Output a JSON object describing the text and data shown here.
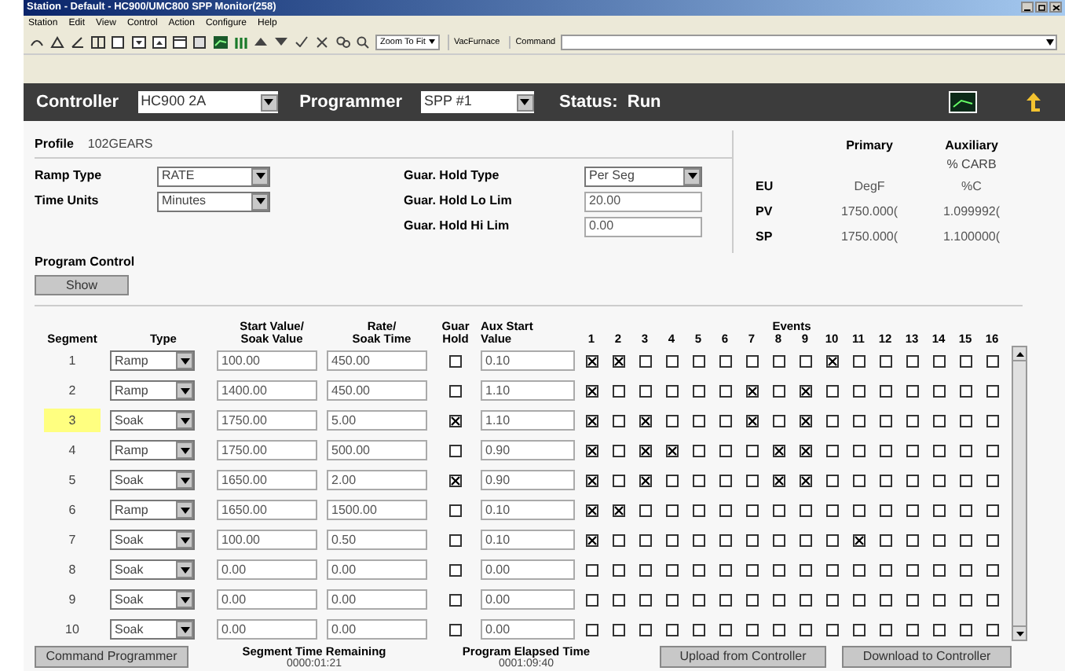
{
  "window": {
    "title": "Station - Default - HC900/UMC800 SPP Monitor(258)"
  },
  "menu": [
    "Station",
    "Edit",
    "View",
    "Control",
    "Action",
    "Configure",
    "Help"
  ],
  "toolbar": {
    "zoom": "Zoom To Fit",
    "furnace_button": "VacFurnace",
    "command_label": "Command"
  },
  "header": {
    "controller_label": "Controller",
    "controller": "HC900 2A",
    "programmer_label": "Programmer",
    "programmer": "SPP #1",
    "status": "Status:  Run"
  },
  "profile": {
    "label": "Profile",
    "value": "102GEARS"
  },
  "settings": [
    {
      "label": "Ramp Type",
      "kind": "select",
      "value": "RATE"
    },
    {
      "label": "Time Units",
      "kind": "select",
      "value": "Minutes"
    }
  ],
  "hold_settings": [
    {
      "label": "Guar. Hold Type",
      "kind": "select",
      "value": "Per Seg"
    },
    {
      "label": "Guar. Hold Lo Lim",
      "kind": "input",
      "value": "20.00"
    },
    {
      "label": "Guar. Hold Hi Lim",
      "kind": "input",
      "value": "0.00"
    }
  ],
  "readings": {
    "columns": [
      "Primary",
      "Auxiliary"
    ],
    "aux_unit": "% CARB",
    "rows": [
      {
        "label": "EU",
        "primary": "DegF",
        "auxiliary": "%C"
      },
      {
        "label": "PV",
        "primary": "1750.000(",
        "auxiliary": "1.099992("
      },
      {
        "label": "SP",
        "primary": "1750.000(",
        "auxiliary": "1.100000("
      }
    ]
  },
  "program_control": {
    "label": "Program Control",
    "button": "Show"
  },
  "table": {
    "columns": [
      "Segment",
      "Type",
      "Start Value/\nSoak Value",
      "Rate/\nSoak Time",
      "Guar\nHold",
      "Aux Start\nValue"
    ],
    "events_label": "Events",
    "event_numbers": [
      "1",
      "2",
      "3",
      "4",
      "5",
      "6",
      "7",
      "8",
      "9",
      "10",
      "11",
      "12",
      "13",
      "14",
      "15",
      "16"
    ],
    "rows": [
      {
        "segment": "1",
        "selected": false,
        "type": "Ramp",
        "start": "100.00",
        "rate": "450.00",
        "hold": false,
        "aux": "0.10",
        "events": [
          true,
          true,
          false,
          false,
          false,
          false,
          false,
          false,
          false,
          true,
          false,
          false,
          false,
          false,
          false,
          false
        ]
      },
      {
        "segment": "2",
        "selected": false,
        "type": "Ramp",
        "start": "1400.00",
        "rate": "450.00",
        "hold": false,
        "aux": "1.10",
        "events": [
          true,
          false,
          false,
          false,
          false,
          false,
          true,
          false,
          true,
          false,
          false,
          false,
          false,
          false,
          false,
          false
        ]
      },
      {
        "segment": "3",
        "selected": true,
        "type": "Soak",
        "start": "1750.00",
        "rate": "5.00",
        "hold": true,
        "aux": "1.10",
        "events": [
          true,
          false,
          true,
          false,
          false,
          false,
          true,
          false,
          true,
          false,
          false,
          false,
          false,
          false,
          false,
          false
        ]
      },
      {
        "segment": "4",
        "selected": false,
        "type": "Ramp",
        "start": "1750.00",
        "rate": "500.00",
        "hold": false,
        "aux": "0.90",
        "events": [
          true,
          false,
          true,
          true,
          false,
          false,
          false,
          true,
          true,
          false,
          false,
          false,
          false,
          false,
          false,
          false
        ]
      },
      {
        "segment": "5",
        "selected": false,
        "type": "Soak",
        "start": "1650.00",
        "rate": "2.00",
        "hold": true,
        "aux": "0.90",
        "events": [
          true,
          false,
          true,
          false,
          false,
          false,
          false,
          true,
          true,
          false,
          false,
          false,
          false,
          false,
          false,
          false
        ]
      },
      {
        "segment": "6",
        "selected": false,
        "type": "Ramp",
        "start": "1650.00",
        "rate": "1500.00",
        "hold": false,
        "aux": "0.10",
        "events": [
          true,
          true,
          false,
          false,
          false,
          false,
          false,
          false,
          false,
          false,
          false,
          false,
          false,
          false,
          false,
          false
        ]
      },
      {
        "segment": "7",
        "selected": false,
        "type": "Soak",
        "start": "100.00",
        "rate": "0.50",
        "hold": false,
        "aux": "0.10",
        "events": [
          true,
          false,
          false,
          false,
          false,
          false,
          false,
          false,
          false,
          false,
          true,
          false,
          false,
          false,
          false,
          false
        ]
      },
      {
        "segment": "8",
        "selected": false,
        "type": "Soak",
        "start": "0.00",
        "rate": "0.00",
        "hold": false,
        "aux": "0.00",
        "events": [
          false,
          false,
          false,
          false,
          false,
          false,
          false,
          false,
          false,
          false,
          false,
          false,
          false,
          false,
          false,
          false
        ]
      },
      {
        "segment": "9",
        "selected": false,
        "type": "Soak",
        "start": "0.00",
        "rate": "0.00",
        "hold": false,
        "aux": "0.00",
        "events": [
          false,
          false,
          false,
          false,
          false,
          false,
          false,
          false,
          false,
          false,
          false,
          false,
          false,
          false,
          false,
          false
        ]
      },
      {
        "segment": "10",
        "selected": false,
        "type": "Soak",
        "start": "0.00",
        "rate": "0.00",
        "hold": false,
        "aux": "0.00",
        "events": [
          false,
          false,
          false,
          false,
          false,
          false,
          false,
          false,
          false,
          false,
          false,
          false,
          false,
          false,
          false,
          false
        ]
      }
    ]
  },
  "footer": {
    "command_button": "Command Programmer",
    "segment_time_label": "Segment Time Remaining",
    "segment_time": "0000:01:21",
    "elapsed_label": "Program Elapsed Time",
    "elapsed": "0001:09:40",
    "upload_button": "Upload from Controller",
    "download_button": "Download to Controller"
  }
}
